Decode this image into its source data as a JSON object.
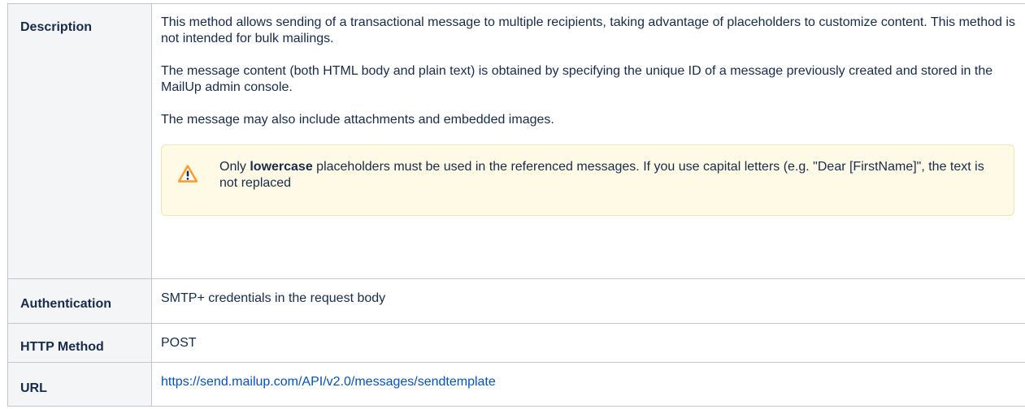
{
  "rows": {
    "description": {
      "label": "Description",
      "paragraph1": "This method allows sending of a transactional message to multiple recipients, taking advantage of placeholders to customize content. This method is not intended for bulk mailings.",
      "paragraph2": "The message content (both HTML body and plain text) is obtained by specifying the unique ID of a message previously created and stored in the MailUp admin console.",
      "paragraph3": "The message may also include attachments and embedded images.",
      "warning": {
        "icon": "warning-icon",
        "text_before": "Only ",
        "text_bold": "lowercase",
        "text_after": " placeholders must be used in the referenced messages. If you use capital letters (e.g. \"Dear [FirstName]\", the text is not replaced"
      }
    },
    "authentication": {
      "label": "Authentication",
      "value": "SMTP+ credentials in the request body"
    },
    "http_method": {
      "label": "HTTP Method",
      "value": "POST"
    },
    "url": {
      "label": "URL",
      "value": "https://send.mailup.com/API/v2.0/messages/sendtemplate"
    }
  },
  "colors": {
    "header_bg": "#f4f5f7",
    "border": "#c1c7d0",
    "warning_bg": "#fffae6",
    "warning_border": "#f4e3ad",
    "warning_icon": "#ff991f",
    "link": "#0052cc"
  }
}
